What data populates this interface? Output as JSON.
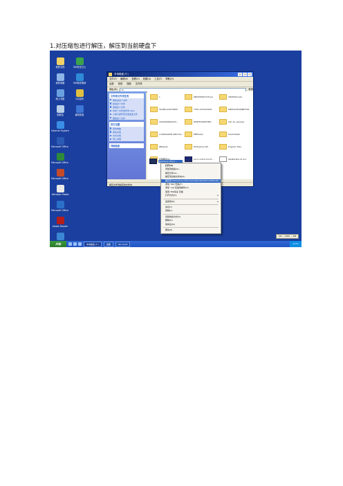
{
  "caption": "1.对压缩包进行解压，解压到当前硬盘下",
  "desktop_icons": [
    {
      "label": "我的文档",
      "color": "#f1d268"
    },
    {
      "label": "360安全卫士",
      "color": "#3ba34c"
    },
    {
      "label": "我的电脑",
      "color": "#8eb4e8"
    },
    {
      "label": "360软件管家",
      "color": "#2e8bd7"
    },
    {
      "label": "网上邻居",
      "color": "#6aa0e0"
    },
    {
      "label": "QQ空间",
      "color": "#e0c040"
    },
    {
      "label": "回收站",
      "color": "#b7cfe8"
    },
    {
      "label": "暴风影音",
      "color": "#3e76d6"
    },
    {
      "label": "Internet Explorer",
      "color": "#3a8ee6"
    },
    {
      "label": "Microsoft Office W...",
      "color": "#2b5bb5"
    },
    {
      "label": "Microsoft Office E...",
      "color": "#2e8a3a"
    },
    {
      "label": "Microsoft Office P...",
      "color": "#c44a2a"
    },
    {
      "label": "Windows Media",
      "color": "#e9e9e9"
    },
    {
      "label": "Microsoft Office O...",
      "color": "#2b70c8"
    },
    {
      "label": "Adobe Reader",
      "color": "#b51d1d"
    },
    {
      "label": "Safari Reader",
      "color": "#3b87d4"
    },
    {
      "label": "Messenger",
      "color": "#4aa83a"
    }
  ],
  "window": {
    "title": "本地磁盘 (F:)",
    "menu": [
      "文件(F)",
      "编辑(E)",
      "查看(V)",
      "收藏(A)",
      "工具(T)",
      "帮助(H)"
    ],
    "toolbar": [
      "后退",
      "前进",
      "搜索",
      "文件夹"
    ],
    "address_label": "地址(D)",
    "address_value": "F:\\",
    "go_label": "转到",
    "status": "解压文件到指定的文件夹"
  },
  "left_panels": [
    {
      "title": "文件和文件夹任务",
      "items": [
        "重命名这个文件",
        "移动这个文件",
        "复制这个文件",
        "将这个文件发布到 Web",
        "以电子邮件形式发送此文件",
        "删除这个文件"
      ]
    },
    {
      "title": "其它位置",
      "items": [
        "我的电脑",
        "我的文档",
        "共享文档",
        "网上邻居"
      ]
    },
    {
      "title": "详细信息",
      "items": []
    }
  ],
  "files": [
    {
      "name": "1",
      "kind": "folder"
    },
    {
      "name": "68020500079 Excel",
      "kind": "folder"
    },
    {
      "name": "2003fileXcode",
      "kind": "folder"
    },
    {
      "name": "5G4R3rw14F29950",
      "kind": "folder"
    },
    {
      "name": "7709 c2534dcf016",
      "kind": "folder"
    },
    {
      "name": "80004C4F4368B7591",
      "kind": "folder"
    },
    {
      "name": "A44440009ba415...",
      "kind": "folder"
    },
    {
      "name": "DM2FD444EC5B6...",
      "kind": "folder"
    },
    {
      "name": "Cat. de, groupes",
      "kind": "folder"
    },
    {
      "name": "ccb904a4008 0004 Sfn...",
      "kind": "folder"
    },
    {
      "name": "EEEDownl",
      "kind": "folder"
    },
    {
      "name": "Kindhotxtab",
      "kind": "folder"
    },
    {
      "name": "RBCardio",
      "kind": "folder"
    },
    {
      "name": "Photoshop CS5",
      "kind": "folder"
    },
    {
      "name": "Program Files",
      "kind": "folder"
    },
    {
      "name": "应用程序(M)",
      "kind": "folder"
    },
    {
      "name": "ph-cn-cs5.0-2.6 01 ...",
      "kind": "ps"
    },
    {
      "name": "SSLNS1NrC-V1.doc",
      "kind": "doc"
    }
  ],
  "selected_file": "Photoshop CS5.6 ...",
  "context_menu": [
    {
      "label": "打开(O)",
      "bold": true
    },
    {
      "label": "添加到档案(A)..."
    },
    {
      "label": "解压文件(A)..."
    },
    {
      "label": "解压到当前文件夹(X)"
    },
    {
      "label": "解压到 Photoshop.CS5.Green\\Portable\\Extra\\PS\\CS5\\...(E)",
      "selected": true
    },
    {
      "label": "添加 \"Zip\"压缩(T)"
    },
    {
      "label": "添加 \"zip\"压缩到邮件(O)"
    },
    {
      "label": "使用 360杀毒 扫描"
    },
    {
      "label": "打开方式(H)",
      "submenu": true
    },
    {
      "sep": true
    },
    {
      "label": "发送到(N)",
      "submenu": true
    },
    {
      "sep": true
    },
    {
      "label": "剪切(T)"
    },
    {
      "label": "复制(C)"
    },
    {
      "sep": true
    },
    {
      "label": "创建快捷方式(S)"
    },
    {
      "label": "删除(D)"
    },
    {
      "label": "重命名(M)"
    },
    {
      "sep": true
    },
    {
      "label": "属性(R)"
    }
  ],
  "taskbar": {
    "start": "开始",
    "tasks": [
      "本地磁盘 (F:)",
      "画图",
      "Microsoft"
    ],
    "active_task": "本地磁盘 (F:)",
    "tray": "11:57",
    "language_bar": "CH ··· DOC ··· EN"
  }
}
